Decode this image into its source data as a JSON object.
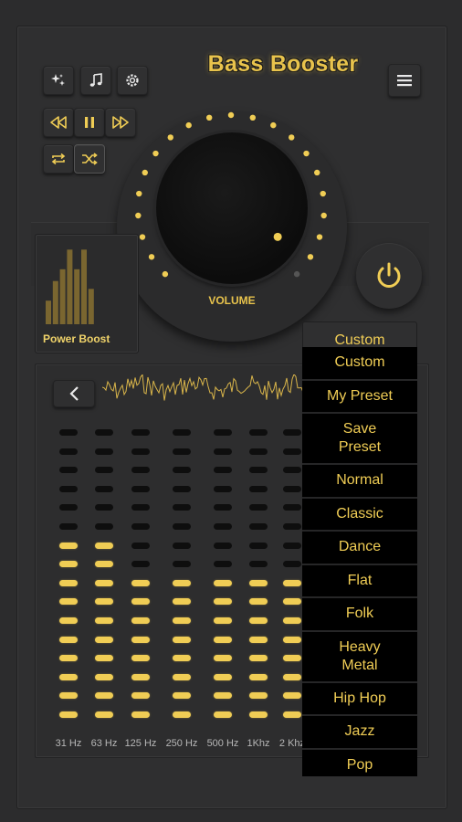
{
  "app": {
    "title": "Bass Booster",
    "accent_color": "#f0cd55",
    "background_color": "#2f2f30"
  },
  "toolbar": {
    "icons": [
      "sparkle-icon",
      "music-note-icon",
      "settings-icon",
      "menu-icon"
    ],
    "media_controls": [
      "rewind-icon",
      "pause-icon",
      "fast-forward-icon",
      "repeat-icon",
      "shuffle-icon"
    ]
  },
  "volume": {
    "label": "VOLUME",
    "level": 0.95
  },
  "power": {
    "icon": "power-icon",
    "state": "on"
  },
  "power_boost": {
    "label": "Power Boost",
    "bars": [
      0.3,
      0.55,
      0.7,
      0.95,
      0.7,
      0.95,
      0.45
    ]
  },
  "equalizer": {
    "bands": [
      {
        "label": "31 Hz",
        "level": 10
      },
      {
        "label": "63 Hz",
        "level": 10
      },
      {
        "label": "125 Hz",
        "level": 8
      },
      {
        "label": "250 Hz",
        "level": 8
      },
      {
        "label": "500 Hz",
        "level": 8
      },
      {
        "label": "1Khz",
        "level": 8
      },
      {
        "label": "2 Khz",
        "level": 8
      }
    ],
    "segments_per_band": 16
  },
  "preset_dropdown": {
    "selected": "Custom",
    "options": [
      {
        "label": "Custom",
        "tall": false
      },
      {
        "label": "My Preset",
        "tall": false
      },
      {
        "label": "Save\nPreset",
        "tall": true
      },
      {
        "label": "Normal",
        "tall": false
      },
      {
        "label": "Classic",
        "tall": false
      },
      {
        "label": "Dance",
        "tall": false
      },
      {
        "label": "Flat",
        "tall": false
      },
      {
        "label": "Folk",
        "tall": false
      },
      {
        "label": "Heavy\nMetal",
        "tall": true
      },
      {
        "label": "Hip Hop",
        "tall": false
      },
      {
        "label": "Jazz",
        "tall": false
      },
      {
        "label": "Pop",
        "tall": false
      }
    ]
  }
}
